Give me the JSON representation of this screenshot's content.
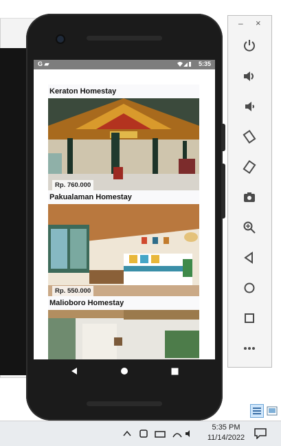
{
  "statusbar": {
    "left": "G ▰",
    "time": "5:35"
  },
  "homestays": [
    {
      "name": "Keraton Homestay",
      "price": "Rp. 760.000"
    },
    {
      "name": "Pakualaman Homestay",
      "price": "Rp. 550.000"
    },
    {
      "name": "Malioboro Homestay",
      "price": ""
    }
  ],
  "emulator_tools": [
    {
      "name": "power-icon"
    },
    {
      "name": "volume-up-icon"
    },
    {
      "name": "volume-down-icon"
    },
    {
      "name": "rotate-left-icon"
    },
    {
      "name": "rotate-right-icon"
    },
    {
      "name": "camera-icon"
    },
    {
      "name": "zoom-icon"
    },
    {
      "name": "back-icon"
    },
    {
      "name": "home-icon"
    },
    {
      "name": "overview-icon"
    },
    {
      "name": "more-icon"
    }
  ],
  "taskbar": {
    "time": "5:35 PM",
    "date": "11/14/2022"
  }
}
